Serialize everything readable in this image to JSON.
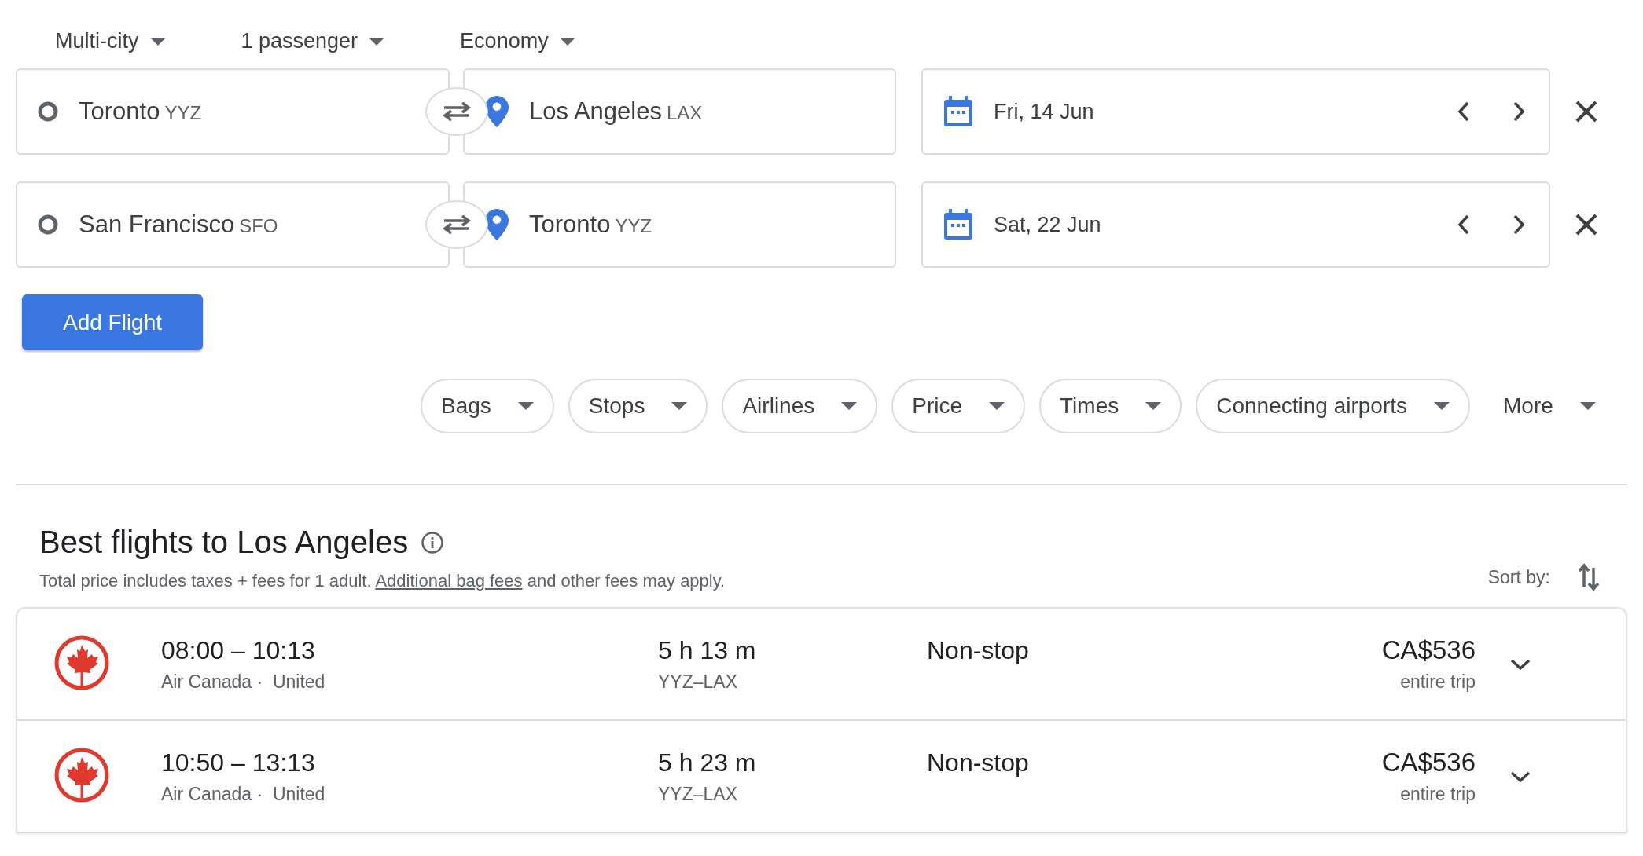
{
  "trip_options": [
    {
      "label": "Multi-city"
    },
    {
      "label": "1 passenger"
    },
    {
      "label": "Economy"
    }
  ],
  "legs": [
    {
      "origin": {
        "city": "Toronto",
        "code": "YYZ"
      },
      "destination": {
        "city": "Los Angeles",
        "code": "LAX"
      },
      "date": "Fri, 14 Jun"
    },
    {
      "origin": {
        "city": "San Francisco",
        "code": "SFO"
      },
      "destination": {
        "city": "Toronto",
        "code": "YYZ"
      },
      "date": "Sat, 22 Jun"
    }
  ],
  "add_flight_button": "Add Flight",
  "filters": [
    {
      "label": "Bags",
      "kind": "chip"
    },
    {
      "label": "Stops",
      "kind": "chip"
    },
    {
      "label": "Airlines",
      "kind": "chip"
    },
    {
      "label": "Price",
      "kind": "chip"
    },
    {
      "label": "Times",
      "kind": "chip"
    },
    {
      "label": "Connecting airports",
      "kind": "chip"
    },
    {
      "label": "More",
      "kind": "plain"
    }
  ],
  "results": {
    "title": "Best flights to Los Angeles",
    "note": {
      "before": "Total price includes taxes + fees for 1 adult.",
      "link": "Additional bag fees",
      "after": "and other fees may apply."
    },
    "sort_label": "Sort by:",
    "flights": [
      {
        "times": "08:00 – 10:13",
        "airlines": "Air Canada ·  United",
        "duration": "5 h 13 m",
        "route": "YYZ–LAX",
        "stops": "Non-stop",
        "price": "CA$536",
        "price_note": "entire trip"
      },
      {
        "times": "10:50 – 13:13",
        "airlines": "Air Canada ·  United",
        "duration": "5 h 23 m",
        "route": "YYZ–LAX",
        "stops": "Non-stop",
        "price": "CA$536",
        "price_note": "entire trip"
      }
    ]
  }
}
